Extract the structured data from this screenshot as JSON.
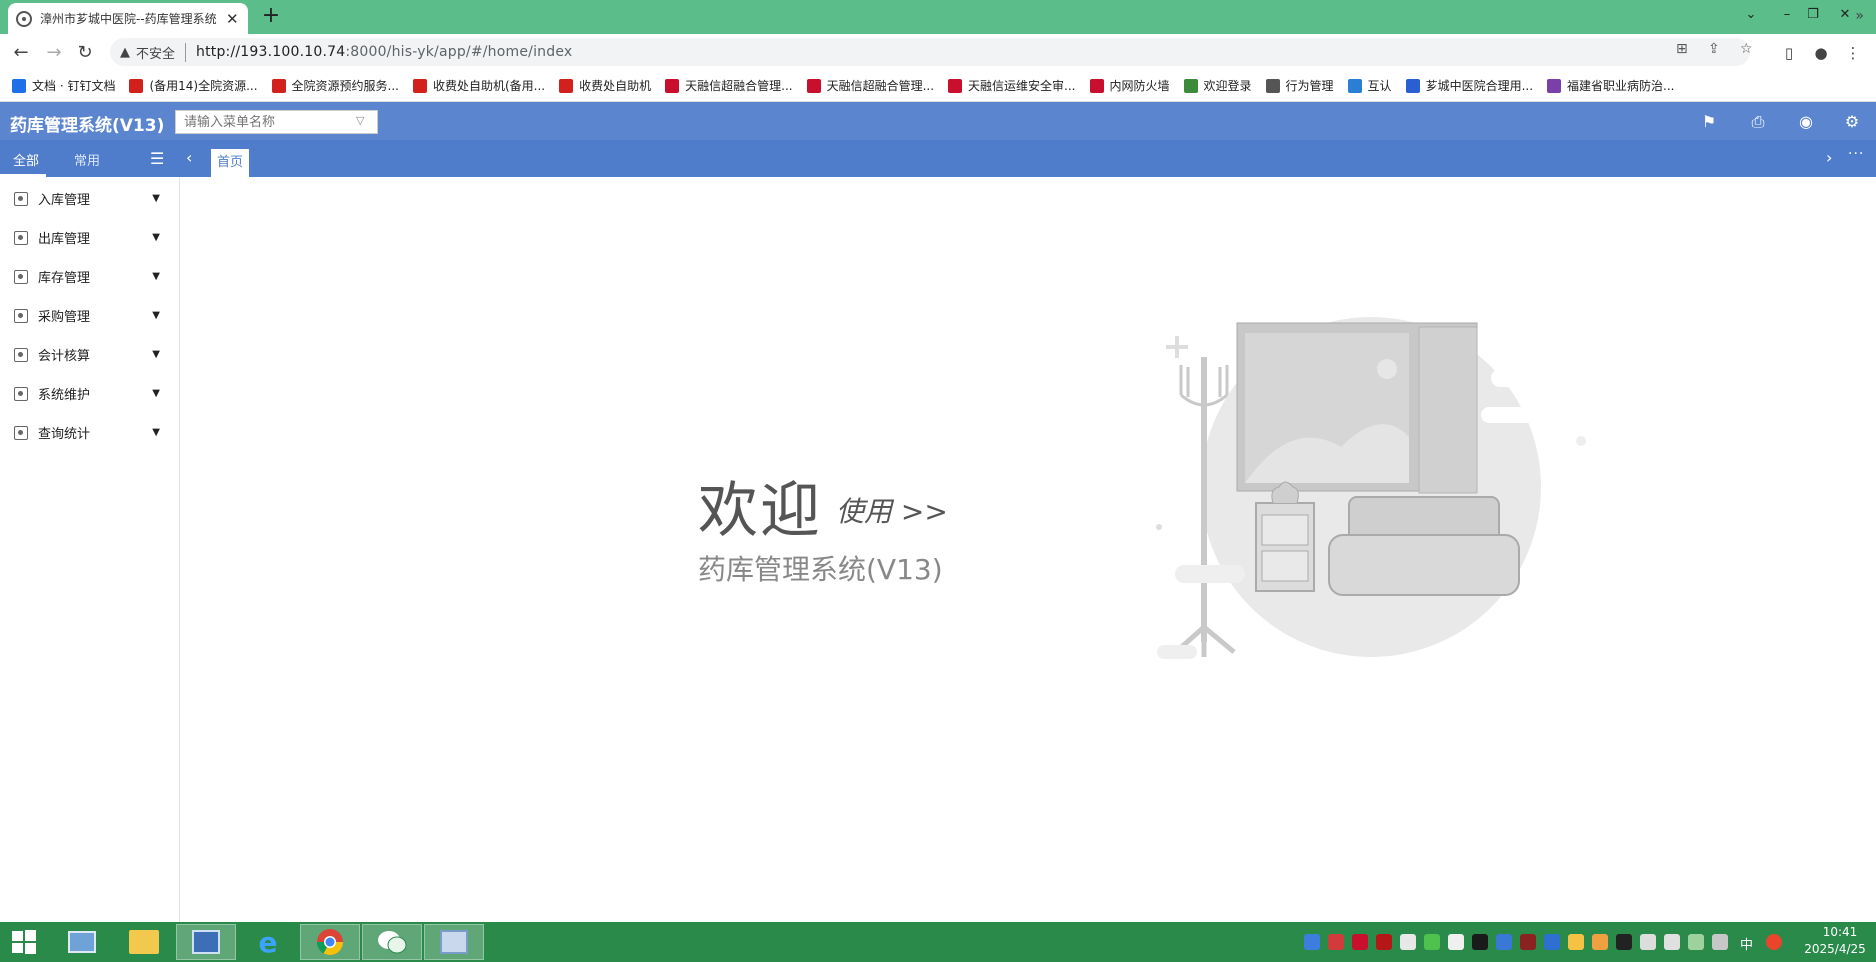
{
  "browser": {
    "tab_title": "漳州市芗城中医院--药库管理系统",
    "new_tab": "+",
    "close_tab": "✕",
    "address": {
      "security_label": "不安全",
      "url_host": "http://193.100.10.74",
      "url_rest": ":8000/his-yk/app/#/home/index"
    },
    "bookmarks": [
      {
        "label": "文档 · 钉钉文档",
        "color": "#1f6fe8"
      },
      {
        "label": "(备用14)全院资源...",
        "color": "#d2211c"
      },
      {
        "label": "全院资源预约服务...",
        "color": "#d2211c"
      },
      {
        "label": "收费处自助机(备用...",
        "color": "#d2211c"
      },
      {
        "label": "收费处自助机",
        "color": "#d2211c"
      },
      {
        "label": "天融信超融合管理...",
        "color": "#c8102e"
      },
      {
        "label": "天融信超融合管理...",
        "color": "#c8102e"
      },
      {
        "label": "天融信运维安全审...",
        "color": "#c8102e"
      },
      {
        "label": "内网防火墙",
        "color": "#c8102e"
      },
      {
        "label": "欢迎登录",
        "color": "#3b8b3b"
      },
      {
        "label": "行为管理",
        "color": "#555555"
      },
      {
        "label": "互认",
        "color": "#2a7fd4"
      },
      {
        "label": "芗城中医院合理用...",
        "color": "#2a5fd4"
      },
      {
        "label": "福建省职业病防治...",
        "color": "#7a3fa8"
      }
    ],
    "bookmarks_more": "»"
  },
  "app": {
    "title": "药库管理系统(V13)",
    "menu_search_placeholder": "请输入菜单名称",
    "nav_tabs": {
      "all": "全部",
      "common": "常用"
    },
    "page_tab": "首页",
    "accent_color": "#5b86cf"
  },
  "sidebar": {
    "items": [
      {
        "label": "入库管理"
      },
      {
        "label": "出库管理"
      },
      {
        "label": "库存管理"
      },
      {
        "label": "采购管理"
      },
      {
        "label": "会计核算"
      },
      {
        "label": "系统维护"
      },
      {
        "label": "查询统计"
      }
    ]
  },
  "main": {
    "welcome": "欢迎",
    "use": "使用 >>",
    "system_name": "药库管理系统(V13)"
  },
  "taskbar": {
    "ime": "中",
    "time": "10:41",
    "date": "2025/4/25"
  }
}
